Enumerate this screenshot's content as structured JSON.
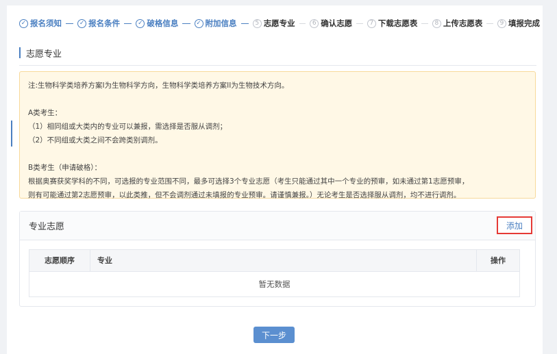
{
  "steps": [
    {
      "num": "✓",
      "label": "报名须知",
      "state": "done"
    },
    {
      "num": "✓",
      "label": "报名条件",
      "state": "done"
    },
    {
      "num": "✓",
      "label": "破格信息",
      "state": "done"
    },
    {
      "num": "✓",
      "label": "附加信息",
      "state": "done"
    },
    {
      "num": "5",
      "label": "志愿专业",
      "state": "todo"
    },
    {
      "num": "6",
      "label": "确认志愿",
      "state": "todo"
    },
    {
      "num": "7",
      "label": "下载志愿表",
      "state": "todo"
    },
    {
      "num": "8",
      "label": "上传志愿表",
      "state": "todo"
    },
    {
      "num": "9",
      "label": "填报完成",
      "state": "todo"
    }
  ],
  "section": {
    "title": "志愿专业"
  },
  "notice": {
    "line1": "注:生物科学类培养方案I为生物科学方向，生物科学类培养方案II为生物技术方向。",
    "a_title": "A类考生：",
    "a1": "（1）相同组或大类内的专业可以兼报，需选择是否服从调剂；",
    "a2": "（2）不同组或大类之间不会跨类别调剂。",
    "b_title": "B类考生（申请破格）：",
    "b1": "根据奥赛获奖学科的不同，可选报的专业范围不同，最多可选择3个专业志愿（考生只能通过其中一个专业的预审，如未通过第1志愿预审，",
    "b2": "则有可能通过第2志愿预审，以此类推，但不会调剂通过未填报的专业预审。请谨慎兼报。）无论考生是否选择服从调剂，均不进行调剂。"
  },
  "panel": {
    "title": "专业志愿",
    "add_label": "添加",
    "columns": [
      "志愿顺序",
      "专业",
      "操作"
    ],
    "empty_text": "暂无数据"
  },
  "next_label": "下一步",
  "colors": {
    "accent": "#4a7fc1",
    "highlight": "#e53935",
    "notice_bg": "#fff8e6"
  }
}
